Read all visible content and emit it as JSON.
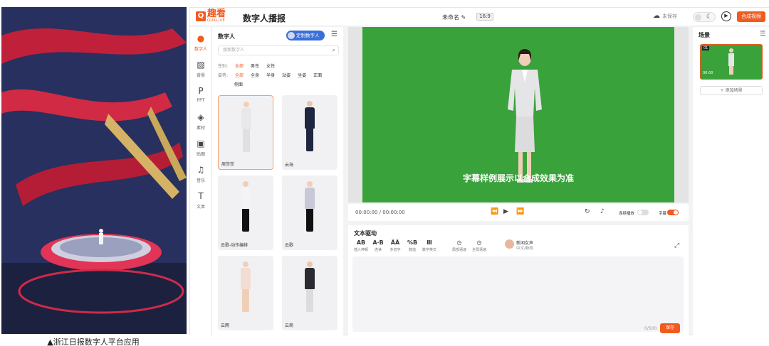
{
  "caption": "▲浙江日报数字人平台应用",
  "header": {
    "logo_mark": "Q",
    "logo_text": "趣看",
    "logo_sub": "QUKLIVE",
    "title": "数字人播报",
    "project_name": "未命名 ✎",
    "aspect_ratio": "16:9",
    "save_state": "未保存",
    "compose_button": "合成视频"
  },
  "nav": [
    {
      "label": "数字人",
      "icon": "person-icon",
      "glyph": "●"
    },
    {
      "label": "背景",
      "icon": "background-icon",
      "glyph": "▨"
    },
    {
      "label": "PPT",
      "icon": "ppt-icon",
      "glyph": "P"
    },
    {
      "label": "素材",
      "icon": "layers-icon",
      "glyph": "◈"
    },
    {
      "label": "贴图",
      "icon": "image-icon",
      "glyph": "▣"
    },
    {
      "label": "音乐",
      "icon": "music-icon",
      "glyph": "♫"
    },
    {
      "label": "文本",
      "icon": "text-icon",
      "glyph": "T"
    }
  ],
  "avatar_panel": {
    "title": "数字人",
    "custom_button": "定制数字人",
    "search_placeholder": "搜索数字人",
    "gender_filters": [
      "性别:",
      "全部",
      "男性",
      "女性"
    ],
    "pose_filters": [
      "姿势:",
      "全部",
      "全身",
      "半身",
      "站姿",
      "坐姿",
      "正面"
    ],
    "pose_filters_extra": "侧面",
    "cards": [
      {
        "name": "周莎莎",
        "selected": true
      },
      {
        "name": "云海",
        "selected": false
      },
      {
        "name": "云歌-动作编排",
        "selected": false
      },
      {
        "name": "云歌",
        "selected": false
      },
      {
        "name": "云雨",
        "selected": false
      },
      {
        "name": "云商",
        "selected": false
      }
    ]
  },
  "preview": {
    "subtitle": "字幕样例展示以合成效果为准",
    "time": "00:00:00 / 00:00:00",
    "loop_label": "连续播放",
    "caption_label": "字幕",
    "loop_on": false,
    "caption_on": true
  },
  "text_drive": {
    "title": "文本驱动",
    "tools": [
      {
        "icon": "AB",
        "label": "插入停顿"
      },
      {
        "icon": "A·B",
        "label": "连读"
      },
      {
        "icon": "ÄÄ",
        "label": "多音字"
      },
      {
        "icon": "%B",
        "label": "数值"
      },
      {
        "icon": "Ⅲ",
        "label": "数字英文"
      },
      {
        "icon": "◷",
        "label": "局部语速"
      },
      {
        "icon": "◷",
        "label": "全局语速"
      }
    ],
    "voice_name": "新闻女声",
    "voice_desc": "中文/新闻",
    "counter": "0/500",
    "save_button": "保存"
  },
  "scene": {
    "title": "场景",
    "thumb_no": "01",
    "thumb_time": "00:00",
    "add_button": "+ 添加场景"
  },
  "colors": {
    "accent": "#f25a1e",
    "green_screen": "#3aa23a",
    "blue": "#3a6fd8"
  }
}
